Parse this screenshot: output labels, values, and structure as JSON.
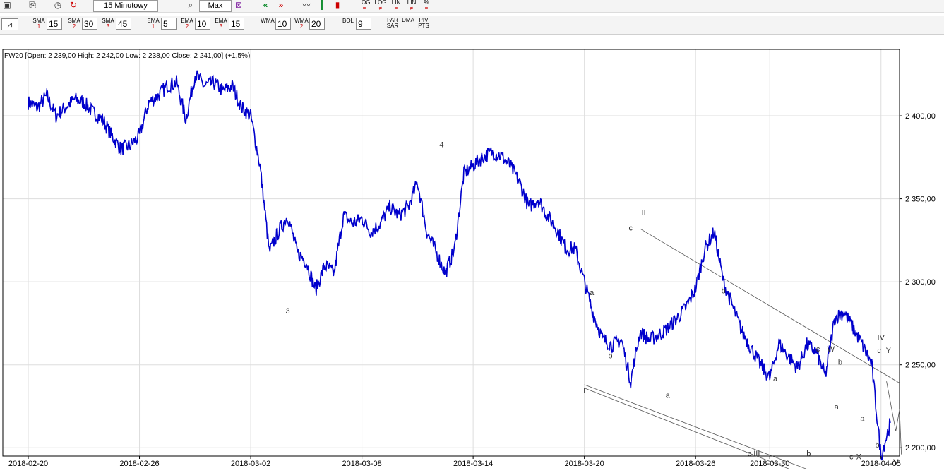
{
  "toolbar1": {
    "interval_label": "15 Minutowy",
    "zoom_label": "Max",
    "scale_buttons": [
      {
        "top": "LOG",
        "bottom": "="
      },
      {
        "top": "LOG",
        "bottom": "≠"
      },
      {
        "top": "LIN",
        "bottom": "="
      },
      {
        "top": "LIN",
        "bottom": "≠"
      },
      {
        "top": "%",
        "bottom": "="
      }
    ]
  },
  "toolbar2": {
    "indicators": [
      {
        "name": "SMA",
        "num": "1",
        "value": "15"
      },
      {
        "name": "SMA",
        "num": "2",
        "value": "30"
      },
      {
        "name": "SMA",
        "num": "3",
        "value": "45"
      },
      {
        "name": "EMA",
        "num": "1",
        "value": "5"
      },
      {
        "name": "EMA",
        "num": "2",
        "value": "10"
      },
      {
        "name": "EMA",
        "num": "3",
        "value": "15"
      },
      {
        "name": "WMA",
        "num": "",
        "value": "10"
      },
      {
        "name": "WMA",
        "num": "2",
        "value": "20"
      },
      {
        "name": "BOL",
        "num": "",
        "value": "9"
      }
    ],
    "extra": [
      {
        "top": "PAR",
        "bottom": "SAR"
      },
      {
        "top": "DMA",
        "bottom": ""
      },
      {
        "top": "PIV",
        "bottom": "PTS"
      }
    ]
  },
  "chart_data": {
    "type": "line",
    "title": "FW20 [Open: 2 239,00   High: 2 242,00   Low: 2 238,00   Close: 2 241,00] (+1,5%)",
    "x_tick_labels": [
      "2018-02-20",
      "2018-02-26",
      "2018-03-02",
      "2018-03-08",
      "2018-03-14",
      "2018-03-20",
      "2018-03-26",
      "2018-03-30",
      "2018-04-05"
    ],
    "y_tick_labels": [
      "2 200,00",
      "2 250,00",
      "2 300,00",
      "2 350,00",
      "2 400,00"
    ],
    "y_ticks": [
      2200,
      2250,
      2300,
      2350,
      2400
    ],
    "ylim": [
      2195,
      2440
    ],
    "x_range_days": [
      0,
      47
    ],
    "x_tick_days": [
      0,
      6,
      12,
      18,
      24,
      30,
      36,
      40,
      46
    ],
    "series": [
      {
        "color": "#0000cc",
        "x": [
          0.0,
          0.5,
          1.0,
          1.5,
          2.0,
          2.5,
          3.0,
          3.5,
          4.0,
          4.5,
          5.0,
          5.5,
          6.0,
          6.5,
          7.0,
          7.5,
          8.0,
          8.5,
          9.0,
          9.5,
          10.0,
          10.5,
          11.0,
          11.5,
          12.0,
          12.5,
          13.0,
          13.5,
          14.0,
          14.5,
          15.0,
          15.5,
          16.0,
          16.5,
          17.0,
          17.5,
          18.0,
          18.5,
          19.0,
          19.5,
          20.0,
          20.5,
          21.0,
          21.5,
          22.0,
          22.5,
          23.0,
          23.5,
          24.0,
          24.5,
          25.0,
          25.5,
          26.0,
          26.5,
          27.0,
          27.5,
          28.0,
          28.5,
          29.0,
          29.5,
          30.0,
          30.5,
          31.0,
          31.5,
          32.0,
          32.5,
          33.0,
          33.5,
          34.0,
          34.5,
          35.0,
          35.5,
          36.0,
          36.5,
          37.0,
          37.5,
          38.0,
          38.5,
          39.0,
          39.5,
          40.0,
          40.5,
          41.0,
          41.5,
          42.0,
          42.5,
          43.0,
          43.5,
          44.0,
          44.5,
          45.0,
          45.5,
          46.0,
          46.5
        ],
        "y": [
          2408,
          2405,
          2412,
          2400,
          2405,
          2410,
          2408,
          2402,
          2398,
          2388,
          2380,
          2382,
          2388,
          2408,
          2412,
          2418,
          2420,
          2398,
          2425,
          2418,
          2420,
          2415,
          2418,
          2405,
          2400,
          2370,
          2318,
          2330,
          2340,
          2318,
          2312,
          2295,
          2310,
          2305,
          2340,
          2335,
          2338,
          2330,
          2335,
          2345,
          2340,
          2345,
          2360,
          2330,
          2318,
          2305,
          2320,
          2365,
          2370,
          2375,
          2378,
          2376,
          2370,
          2360,
          2345,
          2350,
          2340,
          2332,
          2320,
          2320,
          2300,
          2280,
          2265,
          2262,
          2265,
          2240,
          2270,
          2265,
          2268,
          2272,
          2278,
          2285,
          2296,
          2320,
          2330,
          2300,
          2285,
          2270,
          2260,
          2250,
          2242,
          2263,
          2255,
          2248,
          2262,
          2258,
          2243,
          2278,
          2282,
          2272,
          2262,
          2250,
          2195,
          2215
        ],
        "note_gaps": []
      }
    ],
    "wave_labels": [
      {
        "text": "3",
        "x": 14.0,
        "y": 2281
      },
      {
        "text": "4",
        "x": 22.3,
        "y": 2381
      },
      {
        "text": "a",
        "x": 30.4,
        "y": 2292
      },
      {
        "text": "b",
        "x": 31.4,
        "y": 2254
      },
      {
        "text": "I",
        "x": 30.0,
        "y": 2233
      },
      {
        "text": "c",
        "x": 32.5,
        "y": 2331
      },
      {
        "text": "II",
        "x": 33.2,
        "y": 2340
      },
      {
        "text": "a",
        "x": 34.5,
        "y": 2230
      },
      {
        "text": "b",
        "x": 37.5,
        "y": 2293
      },
      {
        "text": "a",
        "x": 40.3,
        "y": 2240
      },
      {
        "text": "c",
        "x": 38.9,
        "y": 2195
      },
      {
        "text": "III",
        "x": 39.3,
        "y": 2195
      },
      {
        "text": "b",
        "x": 42.1,
        "y": 2195
      },
      {
        "text": "c",
        "x": 42.6,
        "y": 2258
      },
      {
        "text": "W",
        "x": 43.3,
        "y": 2258
      },
      {
        "text": "b",
        "x": 43.8,
        "y": 2250
      },
      {
        "text": "a",
        "x": 43.6,
        "y": 2223
      },
      {
        "text": "c",
        "x": 44.4,
        "y": 2193
      },
      {
        "text": "X",
        "x": 44.8,
        "y": 2193
      },
      {
        "text": "a",
        "x": 45.0,
        "y": 2216
      },
      {
        "text": "b",
        "x": 45.8,
        "y": 2200
      },
      {
        "text": "IV",
        "x": 46.0,
        "y": 2265
      },
      {
        "text": "c",
        "x": 45.9,
        "y": 2257
      },
      {
        "text": "Y",
        "x": 46.4,
        "y": 2257
      },
      {
        "text": "V",
        "x": 46.8,
        "y": 2190
      }
    ],
    "trend_lines": [
      {
        "x1": 33.0,
        "y1": 2332,
        "x2": 47.0,
        "y2": 2239
      },
      {
        "x1": 30.0,
        "y1": 2238,
        "x2": 42.5,
        "y2": 2185
      },
      {
        "x1": 30.0,
        "y1": 2236,
        "x2": 42.0,
        "y2": 2183
      }
    ],
    "projection": [
      {
        "x": 46.3,
        "y": 2240
      },
      {
        "x": 46.8,
        "y": 2210
      },
      {
        "x": 47.0,
        "y": 2223
      },
      {
        "x": 47.1,
        "y": 2196
      }
    ],
    "grid": true,
    "legend": "none"
  }
}
